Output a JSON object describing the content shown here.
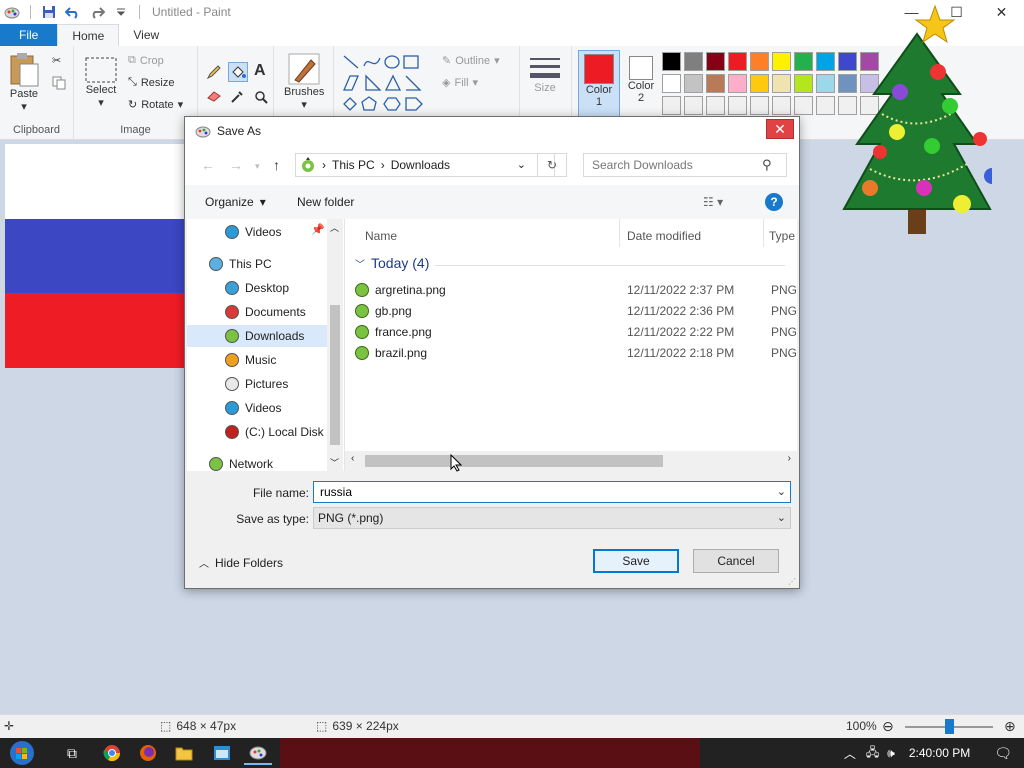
{
  "window": {
    "title": "Untitled - Paint"
  },
  "ribbon": {
    "tabs": [
      "File",
      "Home",
      "View"
    ],
    "clipboard": {
      "label": "Clipboard",
      "paste": "Paste"
    },
    "image": {
      "label": "Image",
      "select": "Select",
      "crop": "Crop",
      "resize": "Resize",
      "rotate": "Rotate"
    },
    "tools": {
      "brushes": "Brushes"
    },
    "shapes": {
      "outline": "Outline",
      "fill": "Fill"
    },
    "size": "Size",
    "color1": {
      "label": "Color",
      "num": "1",
      "value": "#ed1c24"
    },
    "color2": {
      "label": "Color",
      "num": "2",
      "value": "#ffffff"
    },
    "palette": [
      "#000000",
      "#7f7f7f",
      "#880015",
      "#ed1c24",
      "#ff7f27",
      "#fff200",
      "#22b14c",
      "#00a2e8",
      "#3f48cc",
      "#a349a4",
      "#ffffff",
      "#c3c3c3",
      "#b97a57",
      "#ffaec9",
      "#ffc90e",
      "#efe4b0",
      "#b5e61d",
      "#99d9ea",
      "#7092be",
      "#c8bfe7",
      "#f0f0f0",
      "#f0f0f0",
      "#f0f0f0",
      "#f0f0f0",
      "#f0f0f0",
      "#f0f0f0",
      "#f0f0f0",
      "#f0f0f0",
      "#f0f0f0",
      "#f0f0f0"
    ]
  },
  "flag": [
    "#ffffff",
    "#3b47c3",
    "#ee1c25"
  ],
  "dialog": {
    "title": "Save As",
    "breadcrumb": [
      "This PC",
      "Downloads"
    ],
    "search_placeholder": "Search Downloads",
    "organize": "Organize",
    "new_folder": "New folder",
    "help": "?",
    "nav": [
      {
        "label": "Videos",
        "icon": "videos-icon",
        "indent": 1
      },
      {
        "label": "This PC",
        "icon": "computer-icon",
        "indent": 0
      },
      {
        "label": "Desktop",
        "icon": "desktop-icon",
        "indent": 1
      },
      {
        "label": "Documents",
        "icon": "documents-icon",
        "indent": 1
      },
      {
        "label": "Downloads",
        "icon": "downloads-icon",
        "indent": 1,
        "selected": true
      },
      {
        "label": "Music",
        "icon": "music-icon",
        "indent": 1
      },
      {
        "label": "Pictures",
        "icon": "pictures-icon",
        "indent": 1
      },
      {
        "label": "Videos",
        "icon": "videos-icon",
        "indent": 1
      },
      {
        "label": "(C:) Local Disk",
        "icon": "disk-icon",
        "indent": 1
      },
      {
        "label": "Network",
        "icon": "network-icon",
        "indent": 0
      }
    ],
    "columns": {
      "name": "Name",
      "date": "Date modified",
      "type": "Type"
    },
    "group": "Today (4)",
    "files": [
      {
        "name": "argretina.png",
        "date": "12/11/2022 2:37 PM",
        "type": "PNG"
      },
      {
        "name": "gb.png",
        "date": "12/11/2022 2:36 PM",
        "type": "PNG"
      },
      {
        "name": "france.png",
        "date": "12/11/2022 2:22 PM",
        "type": "PNG"
      },
      {
        "name": "brazil.png",
        "date": "12/11/2022 2:18 PM",
        "type": "PNG"
      }
    ],
    "file_name_label": "File name:",
    "file_name_value": "russia",
    "save_type_label": "Save as type:",
    "save_type_value": "PNG (*.png)",
    "hide_folders": "Hide Folders",
    "save": "Save",
    "cancel": "Cancel"
  },
  "status": {
    "selection": "648 × 47px",
    "image_size": "639 × 224px",
    "zoom": "100%",
    "zoom_level": 0.5
  },
  "tray": {
    "time": "2:40:00 PM"
  }
}
